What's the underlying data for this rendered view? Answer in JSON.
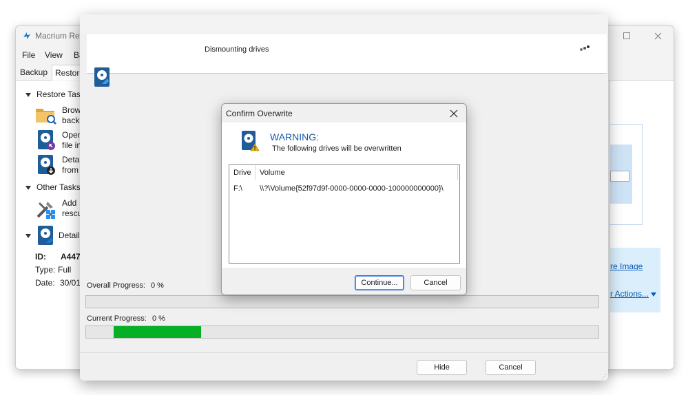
{
  "main_window": {
    "title": "Macrium Ref",
    "menu": [
      "File",
      "View",
      "Ba"
    ],
    "tabs": [
      "Backup",
      "Restore"
    ],
    "sections": {
      "restore_tasks": "Restore Task",
      "other_tasks": "Other Tasks",
      "details": "Details"
    },
    "tasks": [
      {
        "line1": "Brow",
        "line2": "back",
        "icon": "folder-search-icon"
      },
      {
        "line1": "Open",
        "line2": "file in",
        "icon": "disk-open-icon"
      },
      {
        "line1": "Detac",
        "line2": "from",
        "icon": "disk-detach-icon"
      }
    ],
    "other_tasks": [
      {
        "line1": "Add",
        "line2": "rescu",
        "icon": "tools-windows-icon"
      }
    ],
    "details": {
      "id_label": "ID:",
      "id_value": "A447",
      "type_label": "Type:",
      "type_value": "Full",
      "date_label": "Date:",
      "date_value": "30/01"
    },
    "right_links": {
      "restore_image": "re Image",
      "actions": "r Actions..."
    }
  },
  "progress_dialog": {
    "status": "Dismounting drives",
    "overall_label": "Overall Progress:",
    "overall_value": "0 %",
    "overall_fraction": 0,
    "current_label": "Current Progress:",
    "current_value": "0 %",
    "current_indeterminate_segment": true,
    "hide_label": "Hide",
    "cancel_label": "Cancel"
  },
  "confirm_dialog": {
    "title": "Confirm Overwrite",
    "warning_heading": "WARNING:",
    "warning_text": "The following drives will be overwritten",
    "columns": [
      "Drive",
      "Volume"
    ],
    "rows": [
      {
        "drive": "F:\\",
        "volume": "\\\\?\\Volume{52f97d9f-0000-0000-0000-100000000000}\\"
      }
    ],
    "continue_label": "Continue...",
    "cancel_label": "Cancel"
  },
  "colors": {
    "accent": "#0a66b7",
    "progress_green": "#06b025",
    "warning_blue": "#1b5aa8",
    "link_blue": "#0a5cb8"
  }
}
